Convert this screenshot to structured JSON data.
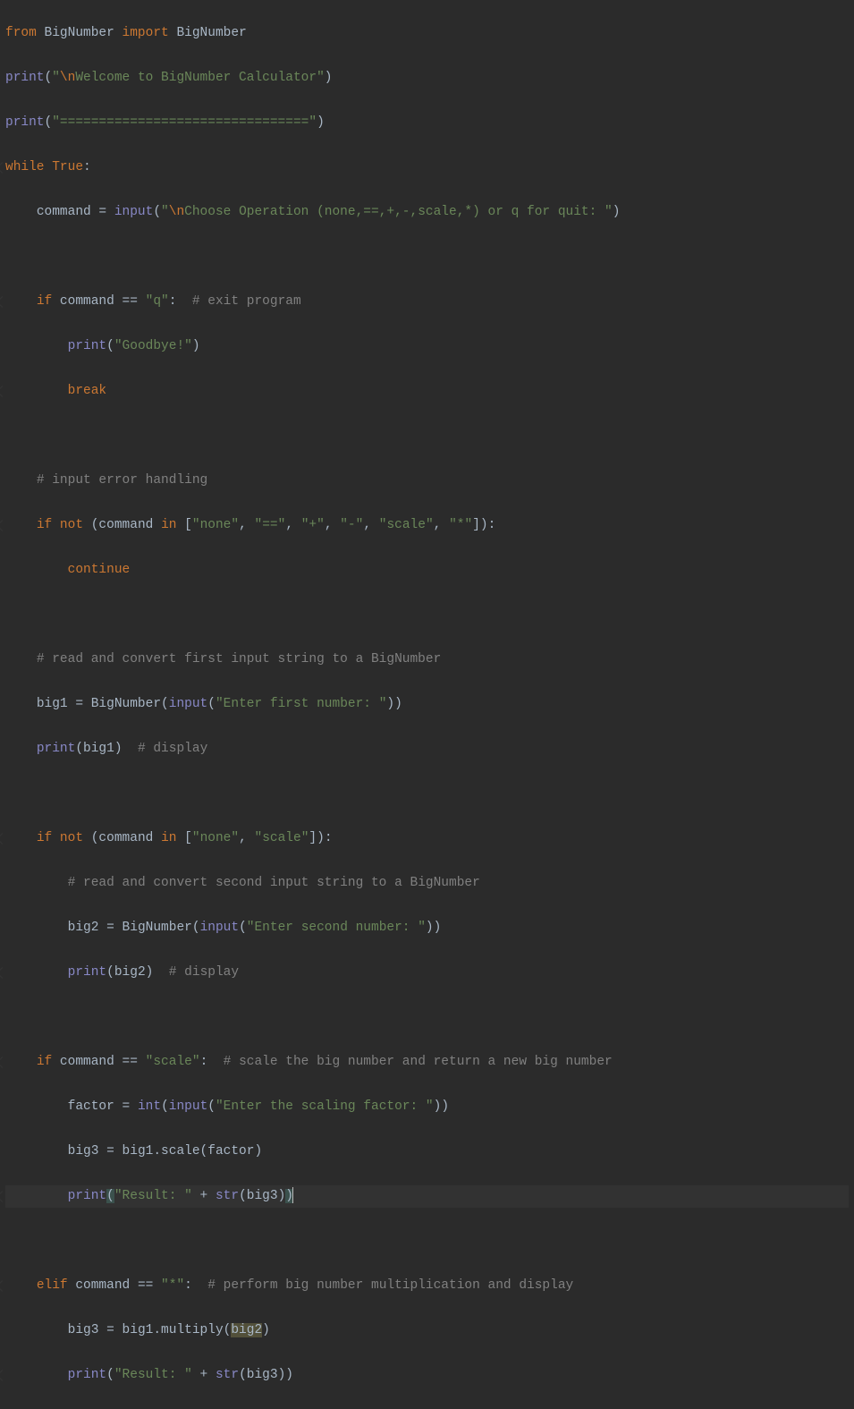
{
  "code": {
    "l1_from": "from",
    "l1_mod": " BigNumber ",
    "l1_import": "import",
    "l1_cls": " BigNumber",
    "l2_print": "print",
    "l2_p1": "(",
    "l2_q1": "\"",
    "l2_esc": "\\n",
    "l2_str": "Welcome to BigNumber Calculator",
    "l2_q2": "\"",
    "l2_p2": ")",
    "l3_print": "print",
    "l3_p1": "(",
    "l3_str": "\"================================\"",
    "l3_p2": ")",
    "l4_while": "while ",
    "l4_true": "True",
    "l4_colon": ":",
    "l5_ind": "    ",
    "l5_var": "command = ",
    "l5_input": "input",
    "l5_p1": "(",
    "l5_q1": "\"",
    "l5_esc": "\\n",
    "l5_str": "Choose Operation (none,==,+,-,scale,*) or q for quit: ",
    "l5_q2": "\"",
    "l5_p2": ")",
    "l7_ind": "    ",
    "l7_if": "if ",
    "l7_cond": "command == ",
    "l7_str": "\"q\"",
    "l7_colon": ":  ",
    "l7_cmt": "# exit program",
    "l8_ind": "        ",
    "l8_print": "print",
    "l8_p1": "(",
    "l8_str": "\"Goodbye!\"",
    "l8_p2": ")",
    "l9_ind": "        ",
    "l9_break": "break",
    "l11_ind": "    ",
    "l11_cmt": "# input error handling",
    "l12_ind": "    ",
    "l12_if": "if not ",
    "l12_p1": "(command ",
    "l12_in": "in ",
    "l12_lb": "[",
    "l12_s1": "\"none\"",
    "l12_c1": ", ",
    "l12_s2": "\"==\"",
    "l12_c2": ", ",
    "l12_s3": "\"+\"",
    "l12_c3": ", ",
    "l12_s4": "\"-\"",
    "l12_c4": ", ",
    "l12_s5": "\"scale\"",
    "l12_c5": ", ",
    "l12_s6": "\"*\"",
    "l12_rb": "]):",
    "l13_ind": "        ",
    "l13_cont": "continue",
    "l15_ind": "    ",
    "l15_cmt": "# read and convert first input string to a BigNumber",
    "l16_ind": "    ",
    "l16_a": "big1 = BigNumber(",
    "l16_input": "input",
    "l16_p1": "(",
    "l16_str": "\"Enter first number: \"",
    "l16_p2": "))",
    "l17_ind": "    ",
    "l17_print": "print",
    "l17_body": "(big1)  ",
    "l17_cmt": "# display",
    "l19_ind": "    ",
    "l19_if": "if not ",
    "l19_p1": "(command ",
    "l19_in": "in ",
    "l19_lb": "[",
    "l19_s1": "\"none\"",
    "l19_c1": ", ",
    "l19_s2": "\"scale\"",
    "l19_rb": "]):",
    "l20_ind": "        ",
    "l20_cmt": "# read and convert second input string to a BigNumber",
    "l21_ind": "        ",
    "l21_a": "big2 = BigNumber(",
    "l21_input": "input",
    "l21_p1": "(",
    "l21_str": "\"Enter second number: \"",
    "l21_p2": "))",
    "l22_ind": "        ",
    "l22_print": "print",
    "l22_body": "(big2)  ",
    "l22_cmt": "# display",
    "l24_ind": "    ",
    "l24_if": "if ",
    "l24_cond": "command == ",
    "l24_str": "\"scale\"",
    "l24_colon": ":  ",
    "l24_cmt": "# scale the big number and return a new big number",
    "l25_ind": "        ",
    "l25_a": "factor = ",
    "l25_int": "int",
    "l25_p1": "(",
    "l25_input": "input",
    "l25_p2": "(",
    "l25_str": "\"Enter the scaling factor: \"",
    "l25_p3": "))",
    "l26_ind": "        ",
    "l26_body": "big3 = big1.scale(factor)",
    "l27_ind": "        ",
    "l27_print": "print",
    "l27_p1": "(",
    "l27_str": "\"Result: \"",
    "l27_plus": " + ",
    "l27_str2": "str",
    "l27_p2": "(big3)",
    "l27_p3": ")",
    "l29_ind": "    ",
    "l29_elif": "elif ",
    "l29_cond": "command == ",
    "l29_str": "\"*\"",
    "l29_colon": ":  ",
    "l29_cmt": "# perform big number multiplication and display",
    "l30_ind": "        ",
    "l30_a": "big3 = big1.multiply(",
    "l30_arg": "big2",
    "l30_p": ")",
    "l31_ind": "        ",
    "l31_print": "print",
    "l31_p1": "(",
    "l31_str": "\"Result: \"",
    "l31_plus": " + ",
    "l31_str2": "str",
    "l31_p2": "(big3))"
  }
}
